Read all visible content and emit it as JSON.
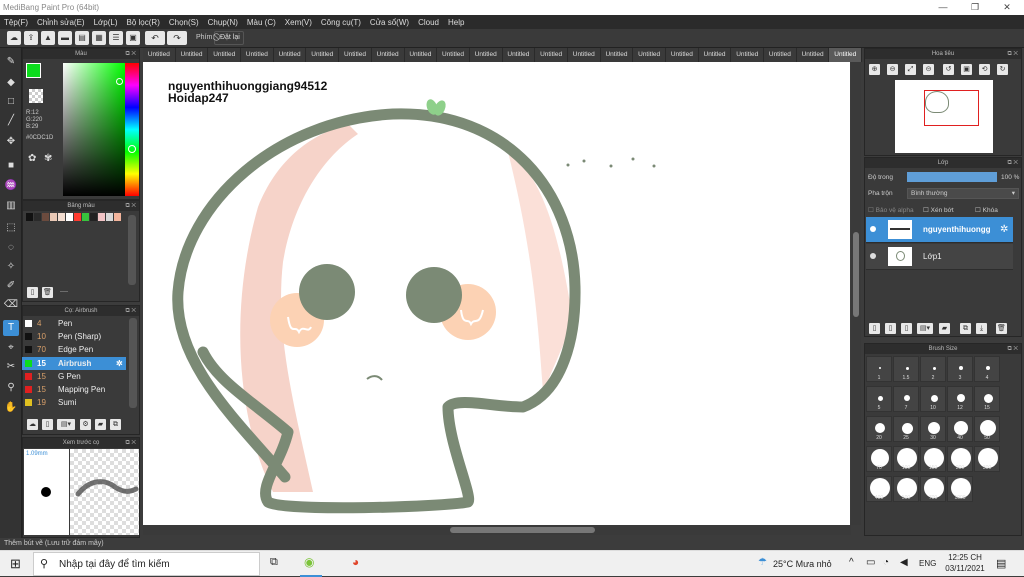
{
  "window": {
    "title": "MediBang Paint Pro (64bit)"
  },
  "menu": [
    "Tệp(F)",
    "Chỉnh sửa(E)",
    "Lớp(L)",
    "Bộ lọc(R)",
    "Chọn(S)",
    "Chụp(N)",
    "Màu (C)",
    "Xem(V)",
    "Công cụ(T)",
    "Cửa sổ(W)",
    "Cloud",
    "Help"
  ],
  "toolbar": {
    "undo": "↶",
    "redo": "↷",
    "phim_label": "Phím",
    "reset_label": "Đặt lại"
  },
  "color_panel": {
    "title": "Màu",
    "r": "R:12",
    "g": "G:220",
    "b": "B:29",
    "hex": "#0CDC1D",
    "fg": "#0CDC1D"
  },
  "palette_panel": {
    "title": "Bảng màu",
    "colors": [
      "#111111",
      "#2a2a2a",
      "#6b4b3e",
      "#e9c8b5",
      "#f3ddd0",
      "#ffffff",
      "#ff3b30",
      "#38c43d",
      "#222222",
      "#f2c4c6",
      "#d8d8d8",
      "#f3b49c"
    ],
    "footer": "----"
  },
  "brush_panel": {
    "title": "Cọ: Airbrush",
    "items": [
      {
        "size": "4",
        "name": "Pen",
        "color": "#ffffff"
      },
      {
        "size": "10",
        "name": "Pen (Sharp)",
        "color": "#111111"
      },
      {
        "size": "70",
        "name": "Edge Pen",
        "color": "#111111"
      },
      {
        "size": "15",
        "name": "Airbrush",
        "color": "#0CDC1D"
      },
      {
        "size": "15",
        "name": "G Pen",
        "color": "#e02020"
      },
      {
        "size": "15",
        "name": "Mapping Pen",
        "color": "#e02020"
      },
      {
        "size": "19",
        "name": "Sumi",
        "color": "#e0c020"
      }
    ]
  },
  "preview_panel": {
    "title": "Xem trước cọ",
    "size": "1.09mm"
  },
  "tabs": [
    "Untitled",
    "Untitled",
    "Untitled",
    "Untitled",
    "Untitled",
    "Untitled",
    "Untitled",
    "Untitled",
    "Untitled",
    "Untitled",
    "Untitled",
    "Untitled",
    "Untitled",
    "Untitled",
    "Untitled",
    "Untitled",
    "Untitled",
    "Untitled",
    "Untitled",
    "Untitled",
    "Untitled",
    "Untitled"
  ],
  "canvas": {
    "text_line1": "nguyenthihuonggiang94512",
    "text_line2": "Hoidap247"
  },
  "navigator_panel": {
    "title": "Hoa tiêu"
  },
  "layer_panel": {
    "title": "Lớp",
    "opacity_label": "Độ trong",
    "opacity_value": "100 %",
    "opacity": 1.0,
    "blend_label": "Pha trộn",
    "blend_value": "Bình thường",
    "protect_alpha": "Bảo vệ alpha",
    "clip": "Xén bớt",
    "lock": "Khóa",
    "layers": [
      {
        "name": "nguyenthihuongg",
        "selected": true
      },
      {
        "name": "Lớp1",
        "selected": false
      }
    ]
  },
  "brushsize_panel": {
    "title": "Brush Size",
    "sizes": [
      "1",
      "1.5",
      "2",
      "3",
      "4",
      "5",
      "7",
      "10",
      "12",
      "15",
      "20",
      "25",
      "30",
      "40",
      "50",
      "70",
      "100",
      "150",
      "200",
      "300",
      "400",
      "500",
      "700",
      "1000"
    ]
  },
  "status": {
    "text": "Thêm bút vẽ (Lưu trữ đám mây)"
  },
  "taskbar": {
    "search_placeholder": "Nhập tại đây để tìm kiếm",
    "weather": "25°C  Mưa nhỏ",
    "lang": "ENG",
    "time": "12:25 CH",
    "date": "03/11/2021"
  }
}
